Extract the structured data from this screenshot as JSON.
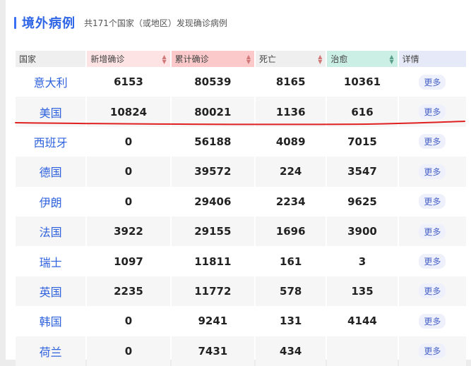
{
  "header": {
    "title": "境外病例",
    "subtitle": "共171个国家（或地区）发现确诊病例"
  },
  "table": {
    "columns": [
      "国家",
      "新增确诊",
      "累计确诊",
      "死亡",
      "治愈",
      "详情"
    ],
    "more_label": "更多",
    "rows": [
      {
        "country": "意大利",
        "new": "6153",
        "total": "80539",
        "death": "8165",
        "cured": "10361"
      },
      {
        "country": "美国",
        "new": "10824",
        "total": "80021",
        "death": "1136",
        "cured": "616"
      },
      {
        "country": "西班牙",
        "new": "0",
        "total": "56188",
        "death": "4089",
        "cured": "7015"
      },
      {
        "country": "德国",
        "new": "0",
        "total": "39572",
        "death": "224",
        "cured": "3547"
      },
      {
        "country": "伊朗",
        "new": "0",
        "total": "29406",
        "death": "2234",
        "cured": "9625"
      },
      {
        "country": "法国",
        "new": "3922",
        "total": "29155",
        "death": "1696",
        "cured": "3900"
      },
      {
        "country": "瑞士",
        "new": "1097",
        "total": "11811",
        "death": "161",
        "cured": "3"
      },
      {
        "country": "英国",
        "new": "2235",
        "total": "11772",
        "death": "578",
        "cured": "135"
      },
      {
        "country": "韩国",
        "new": "0",
        "total": "9241",
        "death": "131",
        "cured": "4144"
      },
      {
        "country": "荷兰",
        "new": "0",
        "total": "7431",
        "death": "434",
        "cured": ""
      }
    ]
  },
  "colors": {
    "accent": "#2f66e8",
    "annotation": "#e02020"
  }
}
